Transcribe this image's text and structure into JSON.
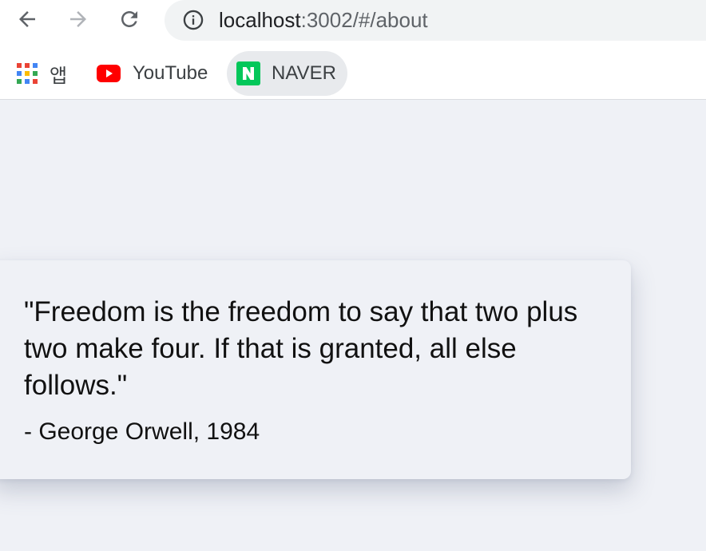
{
  "browser": {
    "back_icon": "arrow-left-icon",
    "forward_icon": "arrow-right-icon",
    "reload_icon": "reload-icon",
    "info_icon": "info-icon",
    "url_host": "localhost",
    "url_rest": ":3002/#/about"
  },
  "bookmarks": {
    "apps_label": "앱",
    "youtube_label": "YouTube",
    "naver_label": "NAVER"
  },
  "content": {
    "quote": "\"Freedom is the freedom to say that two plus two make four. If that is granted, all else follows.\"",
    "author": "- George Orwell, 1984"
  },
  "colors": {
    "page_bg": "#eff1f6",
    "youtube_red": "#ff0000",
    "naver_green": "#03c75a"
  }
}
